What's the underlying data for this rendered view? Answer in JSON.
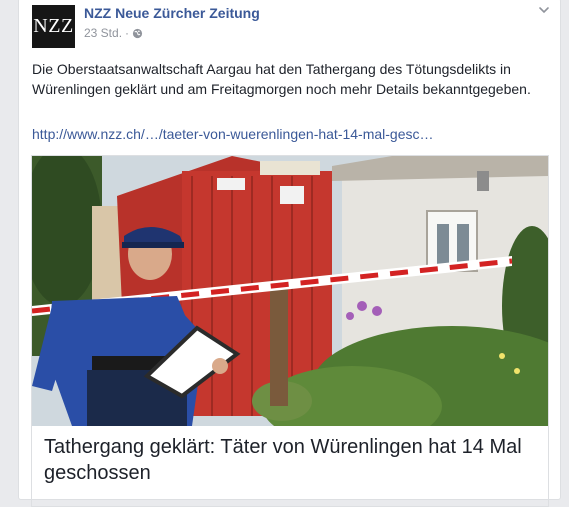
{
  "post": {
    "page_name": "NZZ Neue Zürcher Zeitung",
    "avatar_text": "NZZ",
    "timestamp": "23 Std.",
    "separator": "·",
    "privacy_icon": "globe-icon",
    "menu_icon": "chevron-down-icon",
    "body": "Die Oberstaatsanwaltschaft Aargau hat den Tathergang des Tötungsdelikts in Würenlingen geklärt und am Freitagmorgen noch mehr Details bekanntgegeben.",
    "link_text": "http://www.nzz.ch/…/taeter-von-wuerenlingen-hat-14-mal-gesc…"
  },
  "link_preview": {
    "headline": "Tathergang geklärt: Täter von Würenlingen hat 14 Mal geschossen"
  },
  "colors": {
    "background": "#e9eaed",
    "link_blue": "#3b5998",
    "meta_grey": "#90949c",
    "text": "#1d2129"
  }
}
